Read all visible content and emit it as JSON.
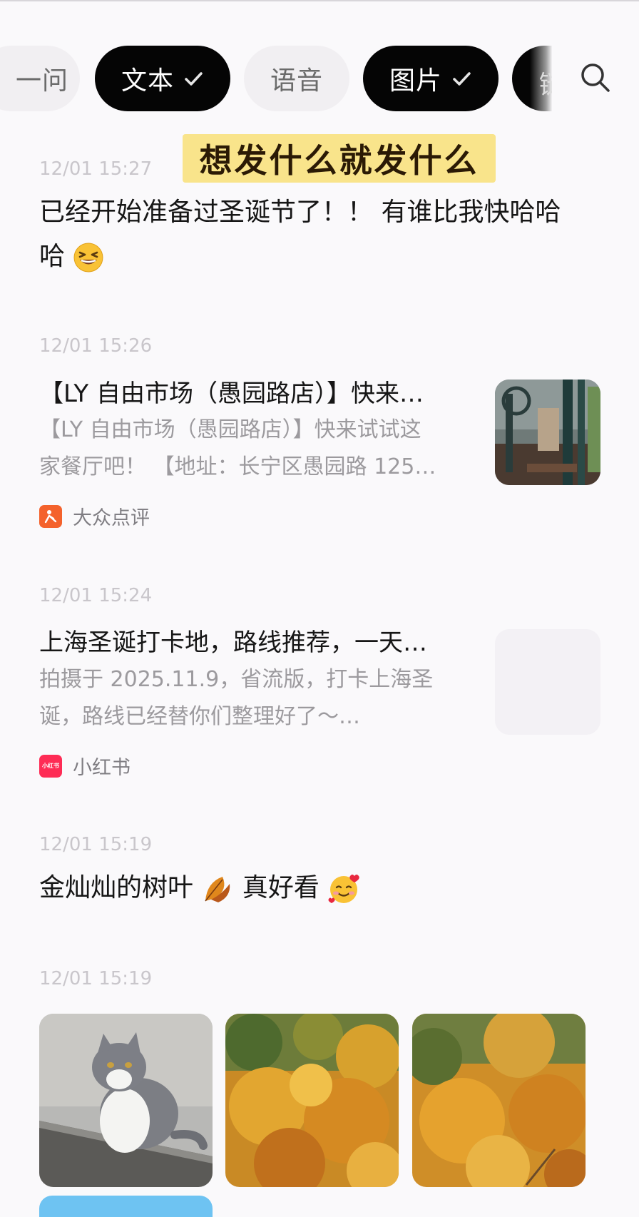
{
  "filters": [
    {
      "label": "一问",
      "selected": false
    },
    {
      "label": "文本",
      "selected": true
    },
    {
      "label": "语音",
      "selected": false
    },
    {
      "label": "图片",
      "selected": true
    },
    {
      "label": "链",
      "selected": true
    }
  ],
  "banner": "想发什么就发什么",
  "messages": [
    {
      "time": "12/01 15:27",
      "line1": "已经开始准备过圣诞节了！！ 有谁比我快哈哈",
      "line2": "哈",
      "emoji": "grinning-squinting-face-emoji"
    },
    {
      "time": "12/01 15:26",
      "title": "【LY 自由市场（愚园路店）】快来…",
      "desc1": "【LY 自由市场（愚园路店）】快来试试这",
      "desc2": "家餐厅吧！ 【地址：长宁区愚园路 125…",
      "source": "大众点评"
    },
    {
      "time": "12/01 15:24",
      "title": "上海圣诞打卡地，路线推荐，一天…",
      "desc1": "拍摄于 2025.11.9，省流版，打卡上海圣",
      "desc2": "诞，路线已经替你们整理好了～…",
      "source": "小红书",
      "source_badge": "小红书"
    },
    {
      "time": "12/01 15:19",
      "text1": "金灿灿的树叶",
      "text2": "真好看",
      "emoji1": "fallen-leaf-emoji",
      "emoji2": "smiling-face-with-hearts-emoji"
    },
    {
      "time": "12/01 15:19",
      "photos": [
        "cat-photo",
        "autumn-tree-photo",
        "autumn-tree-photo"
      ]
    }
  ],
  "colors": {
    "chip_selected": "#050505",
    "chip_unselected": "#f1eff2",
    "banner": "#f9e48b",
    "dianping": "#f4622c",
    "xiaohongshu": "#fe2c55"
  }
}
